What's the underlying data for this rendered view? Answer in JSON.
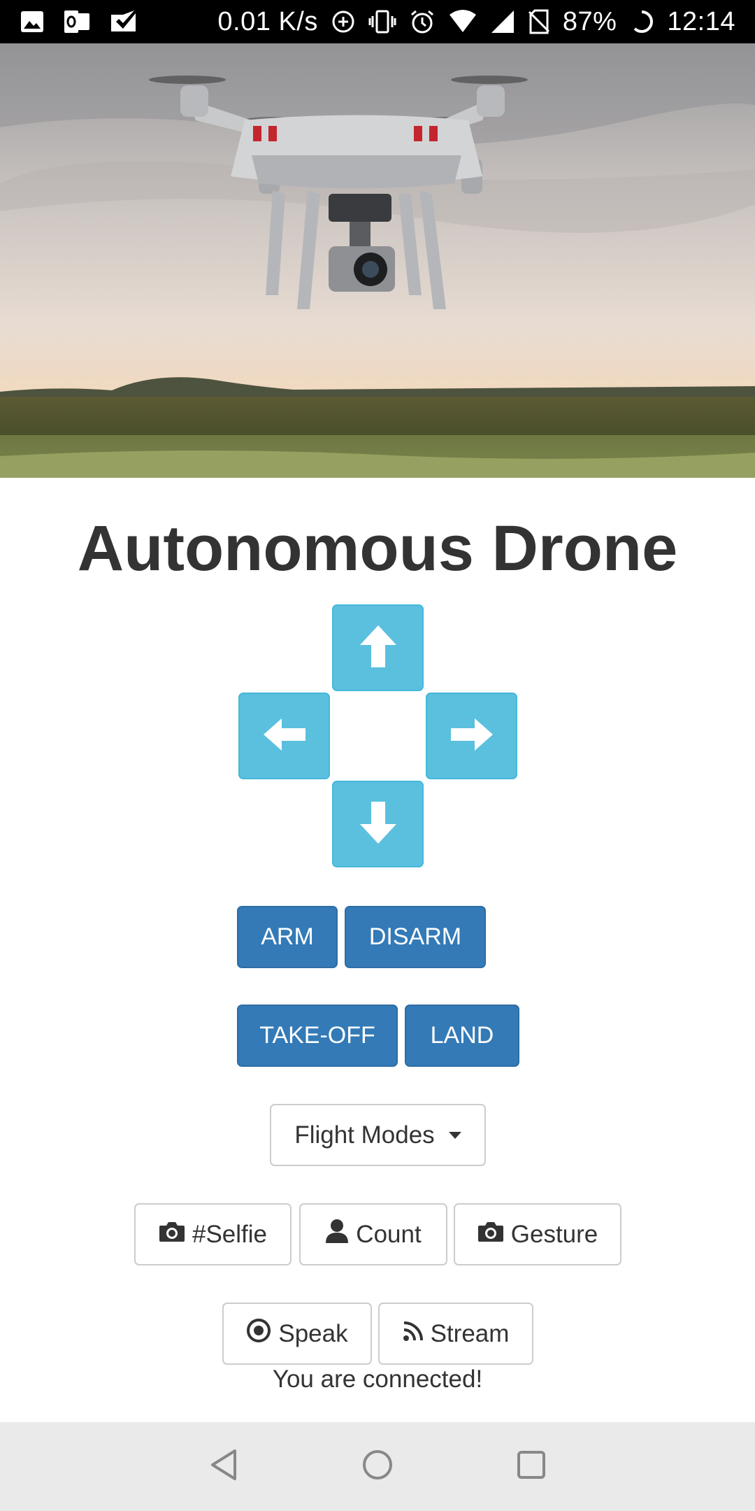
{
  "status_bar": {
    "network_speed": "0.01 K/s",
    "battery": "87%",
    "time": "12:14",
    "left_icons": [
      "image-icon",
      "outlook-icon",
      "inbox-check-icon"
    ],
    "right_icons": [
      "data-saver-icon",
      "vibrate-icon",
      "alarm-icon",
      "wifi-icon",
      "cell-signal-icon",
      "no-sim-icon",
      "battery-icon"
    ]
  },
  "page": {
    "title": "Autonomous Drone"
  },
  "controls": {
    "dpad": {
      "up_icon": "arrow-up-icon",
      "left_icon": "arrow-left-icon",
      "right_icon": "arrow-right-icon",
      "down_icon": "arrow-down-icon"
    },
    "arm_label": "ARM",
    "disarm_label": "DISARM",
    "takeoff_label": "TAKE-OFF",
    "land_label": "LAND",
    "flight_modes_label": "Flight Modes",
    "selfie_label": "#Selfie",
    "count_label": "Count",
    "gesture_label": "Gesture",
    "speak_label": "Speak",
    "stream_label": "Stream"
  },
  "connection_status": "You are connected!",
  "colors": {
    "info": "#5bc0de",
    "primary": "#337ab7",
    "title_text": "#333333",
    "nav_bar": "#eaeaea"
  },
  "nav_bar": {
    "back_icon": "back-triangle-icon",
    "home_icon": "home-circle-icon",
    "recents_icon": "recents-square-icon"
  }
}
